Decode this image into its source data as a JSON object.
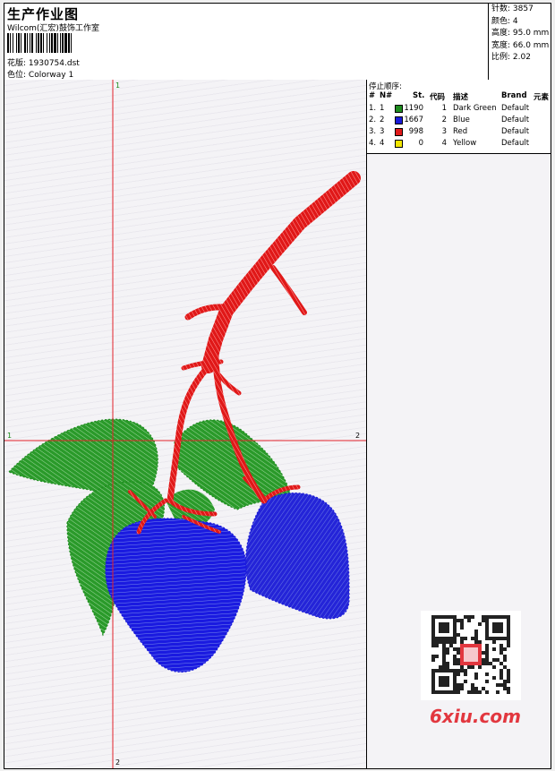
{
  "header": {
    "title": "生产作业图",
    "subtitle": "Wilcom(汇宏)鼓饰工作室",
    "design_label": "花版:",
    "design_value": "1930754.dst",
    "colorway_label": "色位:",
    "colorway_value": "Colorway 1"
  },
  "stats": {
    "stitches": "针数: 3857",
    "colors": "颜色: 4",
    "height": "高度: 95.0 mm",
    "width": "宽度: 66.0 mm",
    "ratio": "比例: 2.02"
  },
  "guides": {
    "v_top": "1",
    "v_bottom": "2",
    "h_left": "1",
    "h_right": "2"
  },
  "stop_sequence": {
    "title": "停止顺序:",
    "columns": [
      "#",
      "N#",
      "St.",
      "代码",
      "描述",
      "Brand",
      "元素"
    ],
    "rows": [
      {
        "num": "1.",
        "n": "1",
        "color": "#1e8c1e",
        "st": "1190",
        "code": "1",
        "desc": "Dark Green",
        "brand": "Default"
      },
      {
        "num": "2.",
        "n": "2",
        "color": "#1a1ad8",
        "st": "1667",
        "code": "2",
        "desc": "Blue",
        "brand": "Default"
      },
      {
        "num": "3.",
        "n": "3",
        "color": "#e01a1a",
        "st": "998",
        "code": "3",
        "desc": "Red",
        "brand": "Default"
      },
      {
        "num": "4.",
        "n": "4",
        "color": "#f2e600",
        "st": "0",
        "code": "4",
        "desc": "Yellow",
        "brand": "Default"
      }
    ]
  },
  "watermark": {
    "site": "6xiu.com"
  }
}
